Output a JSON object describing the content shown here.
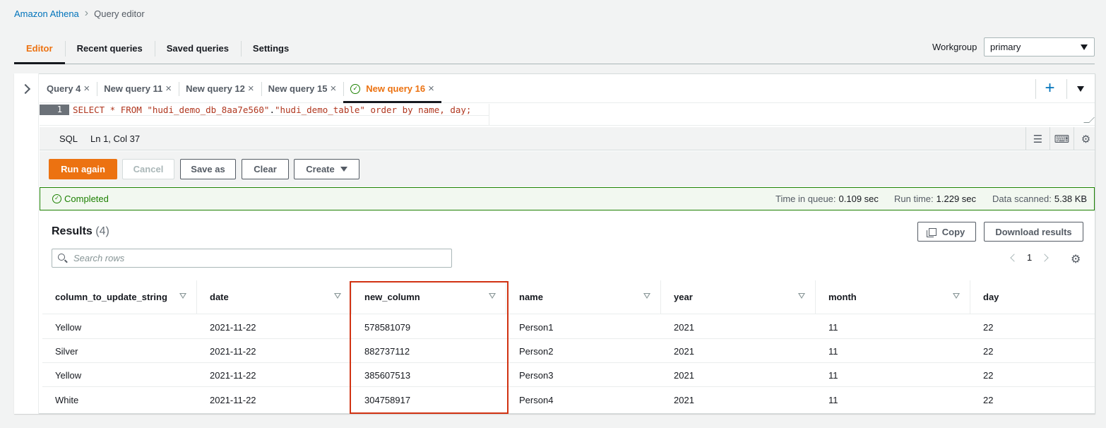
{
  "breadcrumb": {
    "root": "Amazon Athena",
    "current": "Query editor"
  },
  "main_tabs": [
    {
      "label": "Editor",
      "active": true
    },
    {
      "label": "Recent queries",
      "active": false
    },
    {
      "label": "Saved queries",
      "active": false
    },
    {
      "label": "Settings",
      "active": false
    }
  ],
  "workgroup": {
    "label": "Workgroup",
    "value": "primary"
  },
  "query_tabs": [
    {
      "label": "Query 4",
      "active": false
    },
    {
      "label": "New query 11",
      "active": false
    },
    {
      "label": "New query 12",
      "active": false
    },
    {
      "label": "New query 15",
      "active": false
    },
    {
      "label": "New query 16",
      "active": true,
      "status": "completed"
    }
  ],
  "editor": {
    "line_number": "1",
    "code_keyword": "SELECT * FROM ",
    "code_db": "\"hudi_demo_db_8aa7e560\"",
    "code_dot": ".",
    "code_table": "\"hudi_demo_table\"",
    "code_rest": " order by name, day;",
    "language": "SQL",
    "cursor": "Ln 1, Col 37"
  },
  "actions": {
    "run": "Run again",
    "cancel": "Cancel",
    "save_as": "Save as",
    "clear": "Clear",
    "create": "Create"
  },
  "status": {
    "text": "Completed",
    "queue_label": "Time in queue:",
    "queue_value": "0.109 sec",
    "run_label": "Run time:",
    "run_value": "1.229 sec",
    "scanned_label": "Data scanned:",
    "scanned_value": "5.38 KB"
  },
  "results": {
    "title": "Results",
    "count": "(4)",
    "copy": "Copy",
    "download": "Download results",
    "search_placeholder": "Search rows",
    "page": "1",
    "columns": [
      "column_to_update_string",
      "date",
      "new_column",
      "name",
      "year",
      "month",
      "day"
    ],
    "rows": [
      [
        "Yellow",
        "2021-11-22",
        "578581079",
        "Person1",
        "2021",
        "11",
        "22"
      ],
      [
        "Silver",
        "2021-11-22",
        "882737112",
        "Person2",
        "2021",
        "11",
        "22"
      ],
      [
        "Yellow",
        "2021-11-22",
        "385607513",
        "Person3",
        "2021",
        "11",
        "22"
      ],
      [
        "White",
        "2021-11-22",
        "304758917",
        "Person4",
        "2021",
        "11",
        "22"
      ]
    ]
  },
  "colors": {
    "accent": "#ec7211",
    "link": "#0073bb",
    "success": "#1d8102",
    "highlight": "#d13212"
  }
}
